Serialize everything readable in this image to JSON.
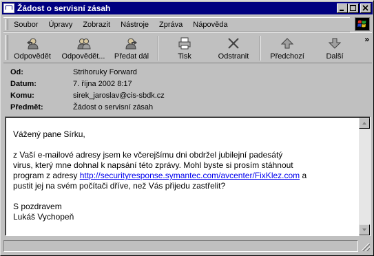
{
  "window": {
    "title": "Žádost o servisní zásah"
  },
  "title_buttons": {
    "minimize": "_",
    "maximize": "□",
    "close": "✕"
  },
  "menu": [
    {
      "label": "Soubor"
    },
    {
      "label": "Úpravy"
    },
    {
      "label": "Zobrazit"
    },
    {
      "label": "Nástroje"
    },
    {
      "label": "Zpráva"
    },
    {
      "label": "Nápověda"
    }
  ],
  "toolbar": {
    "reply": "Odpovědět",
    "reply_all": "Odpovědět...",
    "forward": "Předat dál",
    "print": "Tisk",
    "delete": "Odstranit",
    "previous": "Předchozí",
    "next": "Další",
    "more": "»"
  },
  "headers": {
    "from_label": "Od:",
    "from_value": "Strihoruky Forward",
    "date_label": "Datum:",
    "date_value": "7. října 2002 8:17",
    "to_label": "Komu:",
    "to_value": "sirek_jaroslav@cis-sbdk.cz",
    "subject_label": "Předmět:",
    "subject_value": "Žádost o servisní zásah"
  },
  "message": {
    "greeting": "Vážený pane Sírku,",
    "line1": "z Vaší e-mailové adresy jsem ke včerejšímu dni obdržel jubilejní padesátý",
    "line2": "virus, který mne dohnal k napsání této zprávy. Mohl byste si prosím stáhnout",
    "line3_before": "program z adresy ",
    "link": "http://securityresponse.symantec.com/avcenter/FixKlez.com",
    "line3_after": " a",
    "line4": "pustit jej na svém počítači dříve, než Vás přijedu zastřelit?",
    "closing": "S pozdravem",
    "signature": "Lukáš Vychopeň"
  },
  "colors": {
    "titlebar": "#000080",
    "face": "#c0c0c0",
    "link": "#0000ee"
  }
}
